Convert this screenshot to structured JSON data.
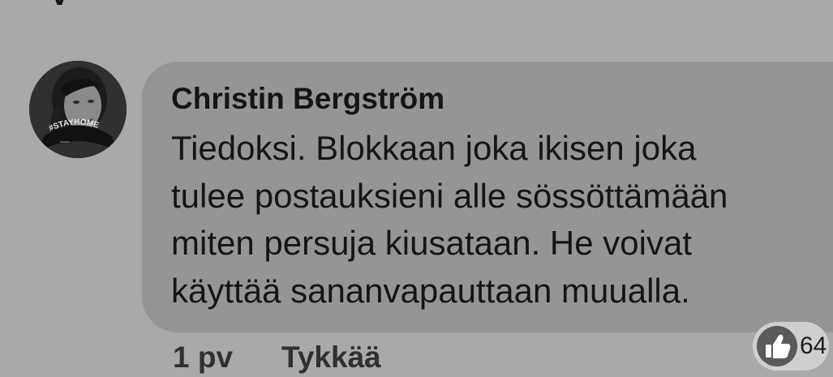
{
  "page": {
    "background_color": "#a9a9a9"
  },
  "comment": {
    "avatar_badge": "#STAYHOME",
    "author": "Christin Bergström",
    "text_lines": [
      "Tiedoksi. Blokkaan joka ikisen joka",
      "tulee postauksieni alle sössöttämään",
      "miten persuja kiusataan. He voivat",
      "käyttää sananvapauttaan muualla."
    ],
    "timestamp": "1 pv",
    "like_label": "Tykkää",
    "reaction_count": "64",
    "reaction_icon": "thumbs-up-icon",
    "bubble_color": "#959595",
    "text_color": "#151515"
  }
}
